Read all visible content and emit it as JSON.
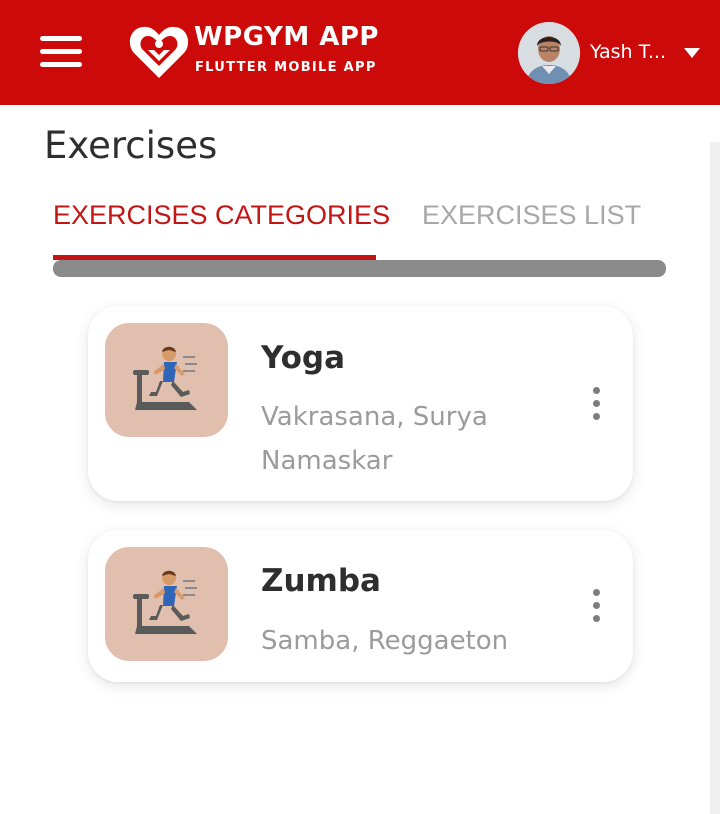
{
  "header": {
    "logo_title": "WPGYM APP",
    "logo_subtitle": "FLUTTER MOBILE APP",
    "user_name": "Yash T...",
    "brand_color": "#cd0a0a"
  },
  "page": {
    "title": "Exercises"
  },
  "tabs": [
    {
      "label": "EXERCISES CATEGORIES",
      "active": true
    },
    {
      "label": "EXERCISES LIST",
      "active": false
    }
  ],
  "categories": [
    {
      "title": "Yoga",
      "description": "Vakrasana, Surya Namaskar",
      "icon": "treadmill-runner-icon"
    },
    {
      "title": "Zumba",
      "description": "Samba, Reggaeton",
      "icon": "treadmill-runner-icon"
    }
  ],
  "colors": {
    "accent": "#c41515",
    "inactive_tab": "#a8a8a8",
    "thumb_bg": "#e1bfae"
  }
}
